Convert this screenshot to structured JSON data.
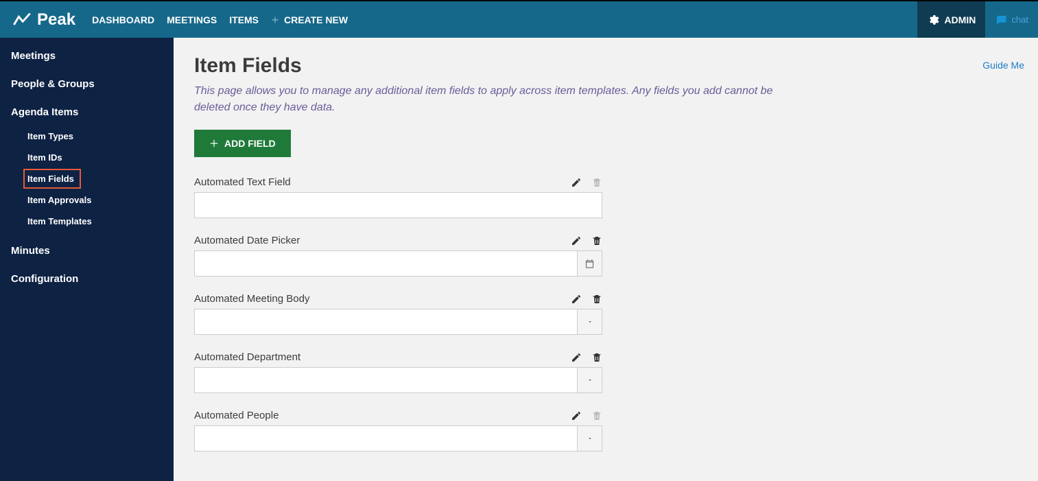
{
  "brand": {
    "name": "Peak"
  },
  "topnav": {
    "dashboard": "DASHBOARD",
    "meetings": "MEETINGS",
    "items": "ITEMS",
    "create_new": "CREATE NEW"
  },
  "topright": {
    "admin": "ADMIN",
    "chat": "chat"
  },
  "sidebar": {
    "meetings": "Meetings",
    "people_groups": "People & Groups",
    "agenda_items": "Agenda Items",
    "sub": {
      "item_types": "Item Types",
      "item_ids": "Item IDs",
      "item_fields": "Item Fields",
      "item_approvals": "Item Approvals",
      "item_templates": "Item Templates"
    },
    "minutes": "Minutes",
    "configuration": "Configuration"
  },
  "page": {
    "title": "Item Fields",
    "description": "This page allows you to manage any additional item fields to apply across item templates. Any fields you add cannot be deleted once they have data.",
    "add_field_label": "ADD FIELD",
    "guide_me": "Guide Me"
  },
  "fields": {
    "f0": {
      "label": "Automated Text Field",
      "value": "",
      "type": "text",
      "can_delete": false
    },
    "f1": {
      "label": "Automated Date Picker",
      "value": "",
      "type": "date",
      "can_delete": true
    },
    "f2": {
      "label": "Automated Meeting Body",
      "value": "",
      "type": "select",
      "can_delete": true
    },
    "f3": {
      "label": "Automated Department",
      "value": "",
      "type": "select",
      "can_delete": true
    },
    "f4": {
      "label": "Automated People",
      "value": "",
      "type": "select",
      "can_delete": false
    }
  }
}
